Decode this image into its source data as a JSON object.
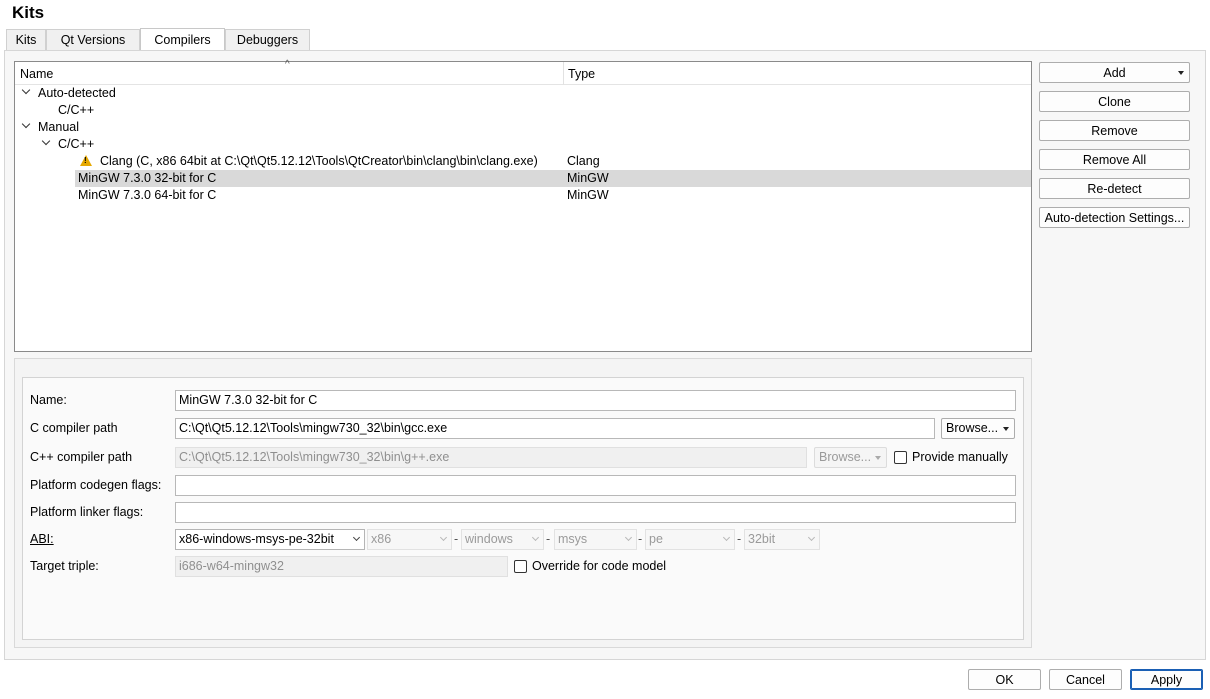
{
  "page": {
    "title": "Kits"
  },
  "tabs": [
    "Kits",
    "Qt Versions",
    "Compilers",
    "Debuggers"
  ],
  "tree": {
    "columns": {
      "name": "Name",
      "type": "Type"
    },
    "rows": [
      {
        "name": "Auto-detected",
        "type": ""
      },
      {
        "name": "C/C++",
        "type": ""
      },
      {
        "name": "Manual",
        "type": ""
      },
      {
        "name": "C/C++",
        "type": ""
      },
      {
        "name": "Clang (C, x86 64bit at C:\\Qt\\Qt5.12.12\\Tools\\QtCreator\\bin\\clang\\bin\\clang.exe)",
        "type": "Clang",
        "icon": "warning-icon"
      },
      {
        "name": "MinGW 7.3.0 32-bit for C",
        "type": "MinGW",
        "selected": true
      },
      {
        "name": "MinGW 7.3.0 64-bit for C",
        "type": "MinGW"
      }
    ]
  },
  "side_buttons": {
    "add": "Add",
    "clone": "Clone",
    "remove": "Remove",
    "remove_all": "Remove All",
    "redetect": "Re-detect",
    "auto_settings": "Auto-detection Settings..."
  },
  "details": {
    "name_label": "Name:",
    "name_value": "MinGW 7.3.0 32-bit for C",
    "c_path_label": "C compiler path",
    "c_path_value": "C:\\Qt\\Qt5.12.12\\Tools\\mingw730_32\\bin\\gcc.exe",
    "browse_label": "Browse...",
    "cpp_path_label": "C++ compiler path",
    "cpp_path_value": "C:\\Qt\\Qt5.12.12\\Tools\\mingw730_32\\bin\\g++.exe",
    "browse_disabled_label": "Browse...",
    "provide_manually_label": "Provide manually",
    "codegen_label": "Platform codegen flags:",
    "codegen_value": "",
    "linker_label": "Platform linker flags:",
    "linker_value": "",
    "abi_label": "ABI:",
    "abi_main": "x86-windows-msys-pe-32bit",
    "abi_arch": "x86",
    "abi_os": "windows",
    "abi_flavor": "msys",
    "abi_format": "pe",
    "abi_width": "32bit",
    "abi_dash": "-",
    "triple_label": "Target triple:",
    "triple_value": "i686-w64-mingw32",
    "override_label": "Override for code model"
  },
  "footer": {
    "ok": "OK",
    "cancel": "Cancel",
    "apply": "Apply"
  }
}
